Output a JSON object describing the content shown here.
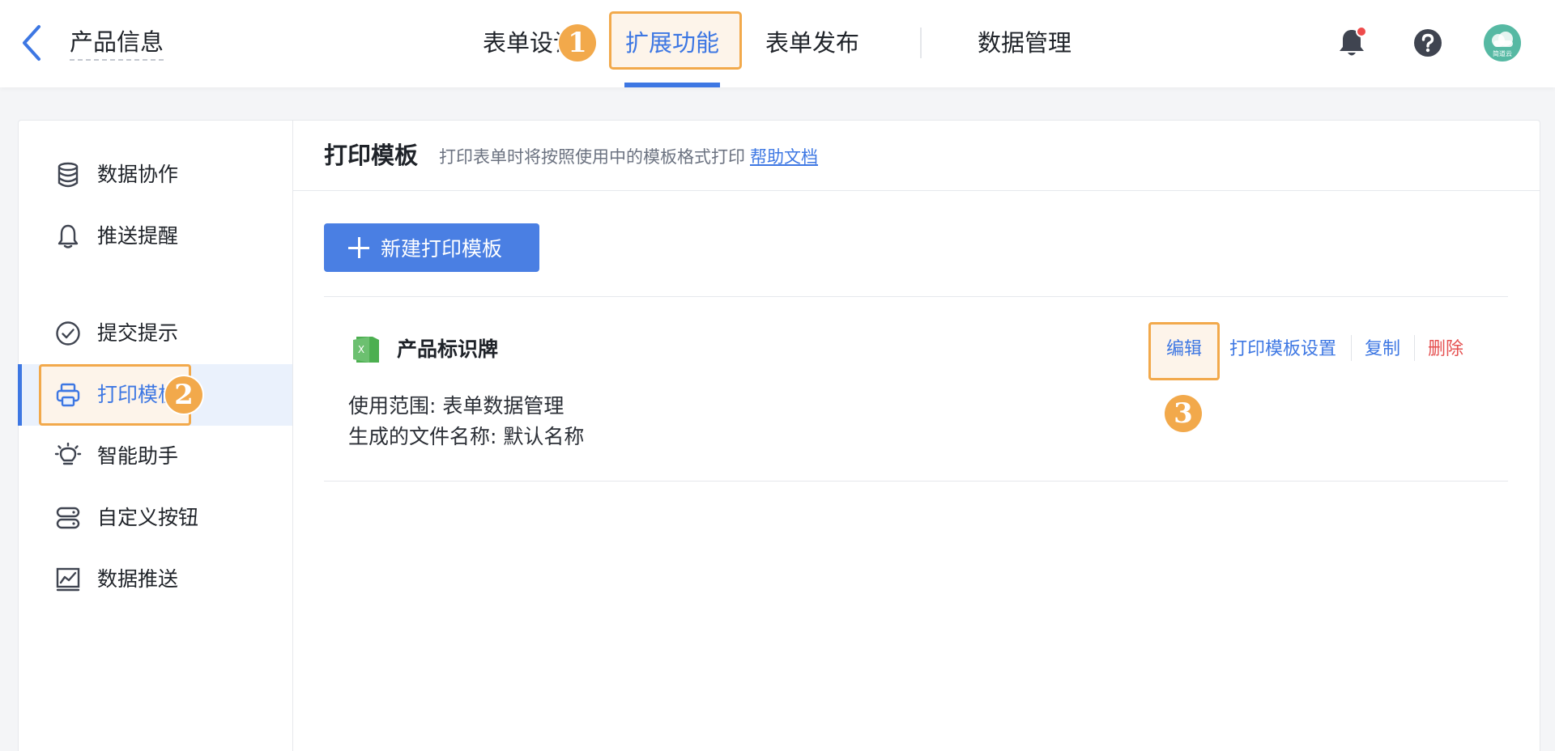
{
  "header": {
    "back_icon": "chevron-left-icon",
    "title": "产品信息",
    "tabs": [
      {
        "label": "表单设计",
        "active": false
      },
      {
        "label": "扩展功能",
        "active": true
      },
      {
        "label": "表单发布",
        "active": false
      },
      {
        "label": "数据管理",
        "active": false
      }
    ],
    "icons": [
      "bell-icon",
      "help-icon"
    ],
    "avatar_text": "简道云"
  },
  "badges": [
    "1",
    "2",
    "3"
  ],
  "sidebar": {
    "items": [
      {
        "label": "数据协作",
        "icon": "database-icon",
        "active": false
      },
      {
        "label": "推送提醒",
        "icon": "bell-outline-icon",
        "active": false
      },
      {
        "label": "提交提示",
        "icon": "check-circle-icon",
        "active": false
      },
      {
        "label": "打印模板",
        "icon": "printer-icon",
        "active": true
      },
      {
        "label": "智能助手",
        "icon": "lightbulb-icon",
        "active": false
      },
      {
        "label": "自定义按钮",
        "icon": "buttons-icon",
        "active": false
      },
      {
        "label": "数据推送",
        "icon": "chart-line-icon",
        "active": false
      }
    ]
  },
  "content": {
    "title": "打印模板",
    "description": "打印表单时将按照使用中的模板格式打印",
    "help_link": "帮助文档",
    "new_button": "新建打印模板",
    "template": {
      "file_icon": "excel-file-icon",
      "file_icon_letter": "X",
      "name": "产品标识牌",
      "scope": "使用范围: 表单数据管理",
      "filename": "生成的文件名称: 默认名称",
      "actions": {
        "edit": "编辑",
        "settings": "打印模板设置",
        "copy": "复制",
        "delete": "删除"
      }
    }
  },
  "colors": {
    "primary": "#3d77e3",
    "highlight": "#f2a94b",
    "danger": "#e55050",
    "excel_green": "#5cb85c"
  }
}
